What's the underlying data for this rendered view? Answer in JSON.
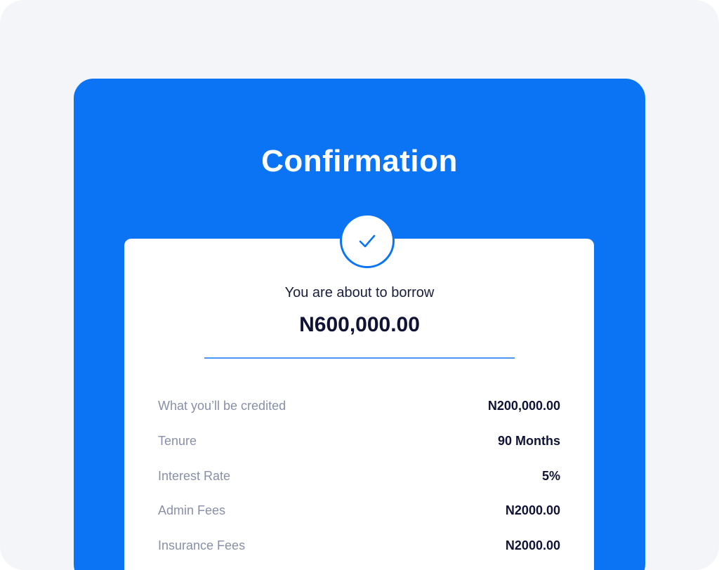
{
  "page": {
    "title": "Confirmation",
    "accent_color": "#0a74f4",
    "icon": "check-icon"
  },
  "summary": {
    "label": "You are about to borrow",
    "amount": "N600,000.00"
  },
  "details": [
    {
      "label": "What you’ll be credited",
      "value": "N200,000.00"
    },
    {
      "label": "Tenure",
      "value": "90 Months"
    },
    {
      "label": "Interest Rate",
      "value": "5%"
    },
    {
      "label": "Admin Fees",
      "value": "N2000.00"
    },
    {
      "label": "Insurance Fees",
      "value": "N2000.00"
    }
  ]
}
